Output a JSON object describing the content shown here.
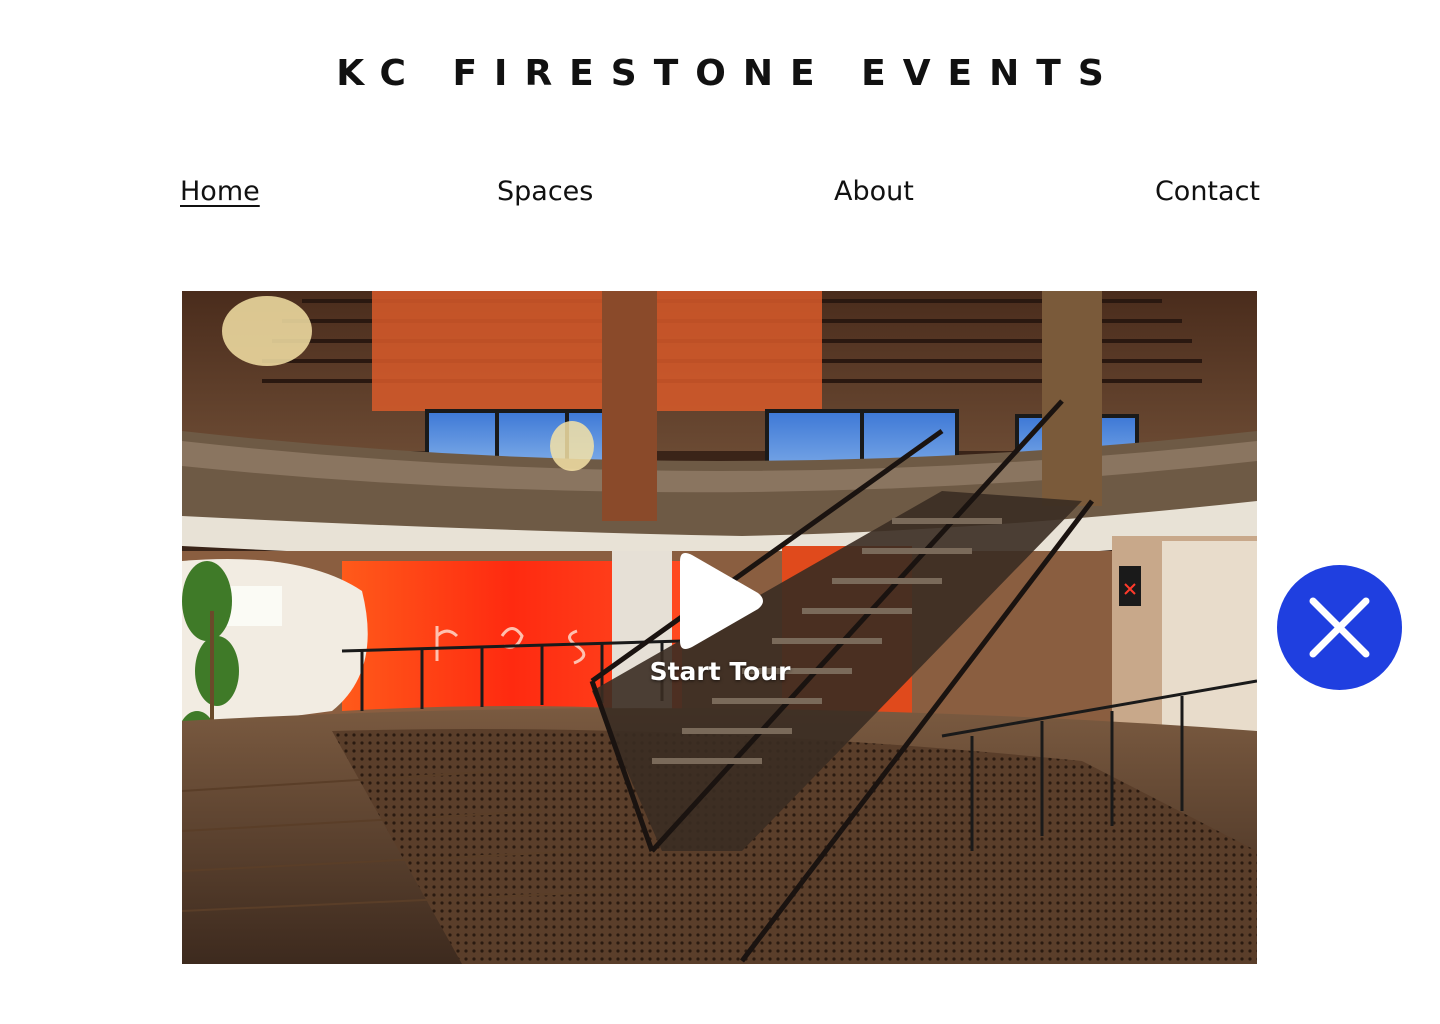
{
  "site": {
    "title": "KC FIRESTONE EVENTS"
  },
  "nav": {
    "items": [
      {
        "label": "Home",
        "active": true
      },
      {
        "label": "Spaces",
        "active": false
      },
      {
        "label": "About",
        "active": false
      },
      {
        "label": "Contact",
        "active": false
      }
    ]
  },
  "tour": {
    "start_label": "Start Tour",
    "play_icon": "play-icon"
  },
  "close": {
    "icon": "close-icon"
  },
  "colors": {
    "close_button_bg": "#1f3fe0",
    "text": "#111111",
    "neon_wall": "#ff3a1a"
  }
}
